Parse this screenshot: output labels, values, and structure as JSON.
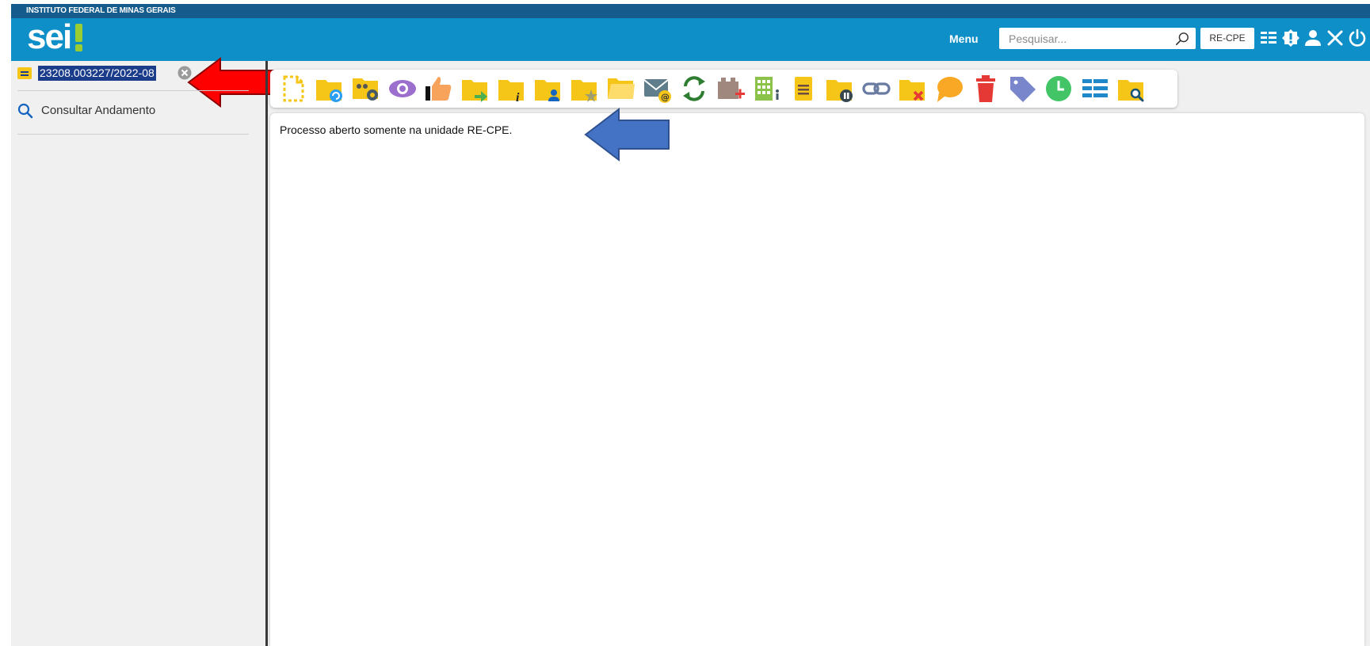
{
  "header": {
    "institution": "INSTITUTO FEDERAL DE MINAS GERAIS",
    "logo": "sei",
    "menu_label": "Menu",
    "search_placeholder": "Pesquisar...",
    "unit": "RE-CPE",
    "icons": [
      "list-icon",
      "alert-icon",
      "user-icon",
      "tools-icon",
      "power-icon"
    ]
  },
  "sidebar": {
    "process_number": "23208.003227/2022-08",
    "consult_label": "Consultar Andamento"
  },
  "toolbar": {
    "icons": [
      "new-document-icon",
      "update-process-icon",
      "manage-process-icon",
      "view-icon",
      "sign-icon",
      "send-process-icon",
      "process-info-icon",
      "assign-user-icon",
      "favorite-folder-icon",
      "open-folder-icon",
      "send-email-icon",
      "refresh-icon",
      "add-block-icon",
      "units-icon",
      "note-icon",
      "suspend-process-icon",
      "link-icon",
      "delete-process-icon",
      "comment-icon",
      "trash-icon",
      "tag-icon",
      "clock-icon",
      "list-view-icon",
      "search-folder-icon"
    ]
  },
  "content": {
    "message": "Processo aberto somente na unidade RE-CPE."
  },
  "colors": {
    "header_top": "#155c8c",
    "header_main": "#0f8fc8",
    "folder": "#f5c518",
    "selection": "#1a3c8a",
    "annotation_red": "#ff0000",
    "annotation_blue": "#4472c4"
  }
}
